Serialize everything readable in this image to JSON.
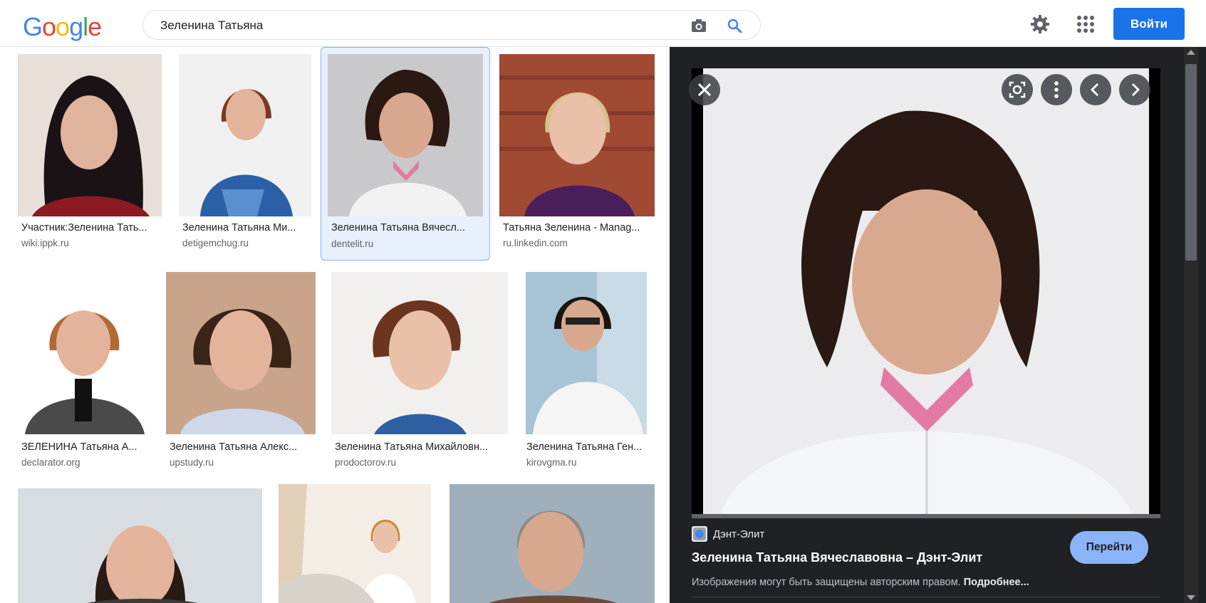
{
  "header": {
    "logo_text": "Google",
    "search_query": "Зеленина Татьяна",
    "signin_label": "Войти",
    "icons": [
      "camera-icon",
      "search-icon",
      "gear-icon",
      "apps-icon"
    ]
  },
  "results": [
    {
      "title": "Участник:Зеленина Тать...",
      "source": "wiki.ippk.ru"
    },
    {
      "title": "Зеленина Татьяна Ми...",
      "source": "detigemchug.ru"
    },
    {
      "title": "Зеленина Татьяна Вячесл...",
      "source": "dentelit.ru"
    },
    {
      "title": "Татьяна Зеленина - Manag...",
      "source": "ru.linkedin.com"
    },
    {
      "title": "ЗЕЛЕНИНА Татьяна А...",
      "source": "declarator.org"
    },
    {
      "title": "Зеленина Татьяна Алекс...",
      "source": "upstudy.ru"
    },
    {
      "title": "Зеленина Татьяна Михайловн...",
      "source": "prodoctorov.ru"
    },
    {
      "title": "Зеленина Татьяна Ген...",
      "source": "kirovgma.ru"
    }
  ],
  "preview": {
    "site_name": "Дэнт-Элит",
    "title": "Зеленина Татьяна Вячеславовна – Дэнт-Элит",
    "visit_label": "Перейти",
    "copyright_text": "Изображения могут быть защищены авторским правом.",
    "more_link": "Подробнее..."
  },
  "colors": {
    "accent": "#1a73e8",
    "panel_bg": "#202124",
    "visit_button": "#8ab4f8"
  }
}
